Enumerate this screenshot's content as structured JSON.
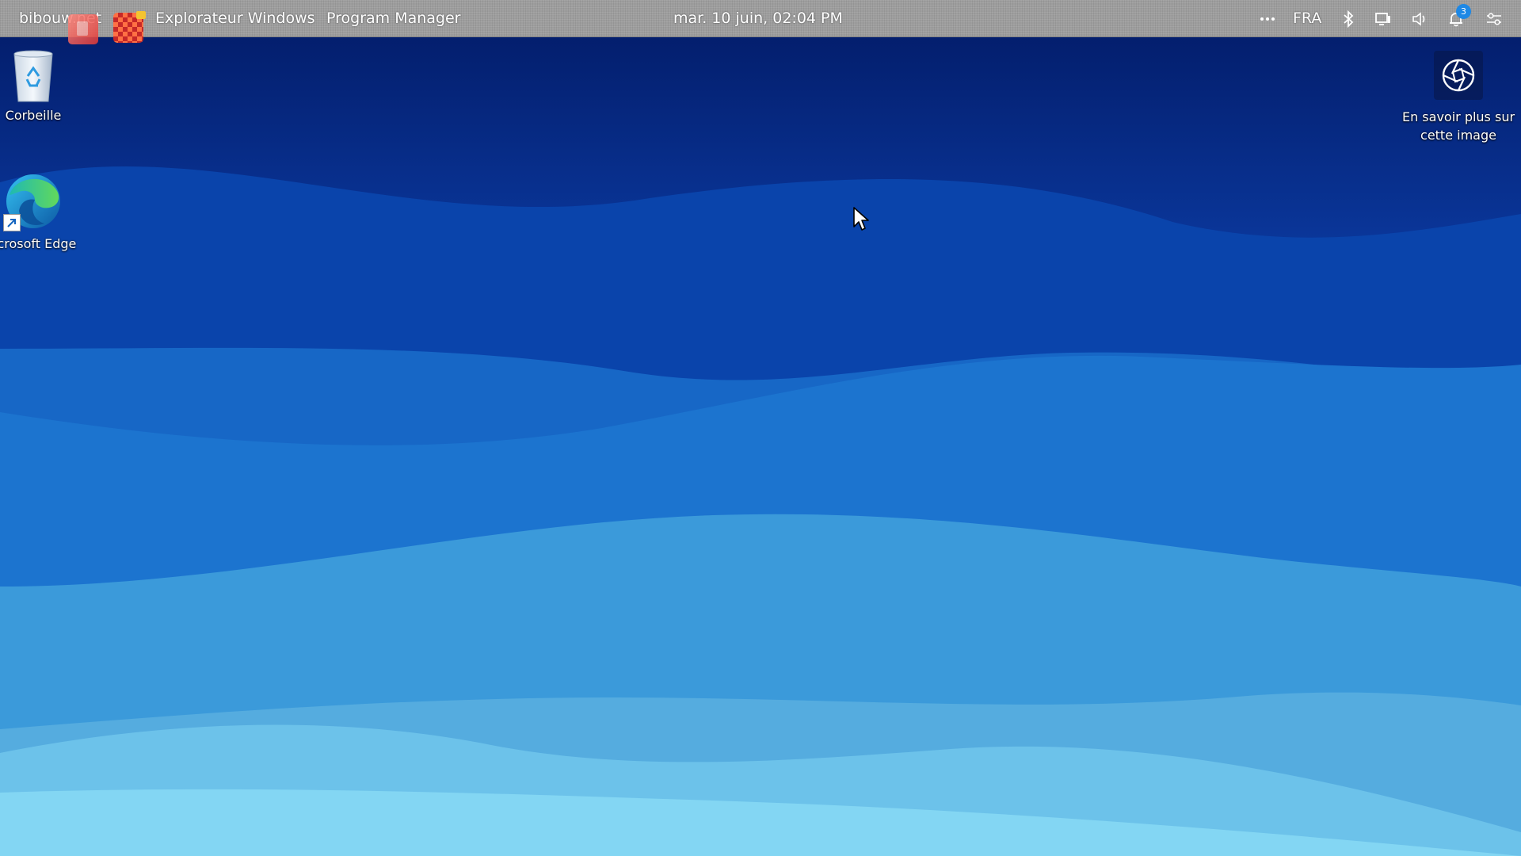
{
  "topbar": {
    "user_menu": "bibouw.net",
    "window_title": "Explorateur Windows",
    "app_title": "Program Manager",
    "datetime": "mar. 10 juin, 02:04 PM",
    "language": "FRA",
    "notification_count": "3",
    "icons": [
      "app-icon",
      "app-icon",
      "more-icon",
      "bluetooth-icon",
      "display-icon",
      "volume-icon",
      "notification-icon",
      "settings-icon"
    ]
  },
  "desktop": {
    "items": [
      {
        "label": "Corbeille",
        "icon": "recycle-bin-icon"
      },
      {
        "label": "icrosoft Edge",
        "icon": "edge-icon"
      }
    ],
    "spotlight": {
      "label": "En savoir plus sur cette image",
      "icon": "camera-icon"
    }
  },
  "colors": {
    "topbar": "#9d9d9d",
    "wallpaper_dark": "#08287f",
    "wallpaper_light": "#83dcf6",
    "badge": "#1e88e5"
  }
}
